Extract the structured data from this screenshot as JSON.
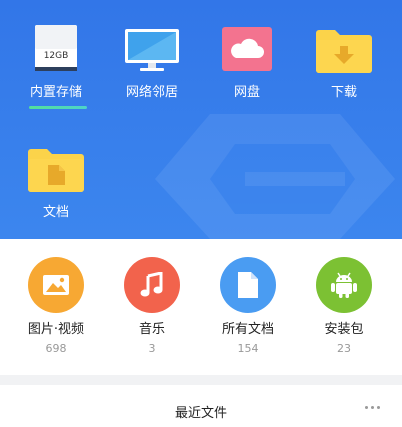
{
  "locations": [
    {
      "label": "内置存储",
      "icon": "storage-drive-icon",
      "capacity": "12GB",
      "active": true
    },
    {
      "label": "网络邻居",
      "icon": "monitor-icon"
    },
    {
      "label": "网盘",
      "icon": "cloud-icon"
    },
    {
      "label": "下载",
      "icon": "download-folder-icon"
    },
    {
      "label": "文档",
      "icon": "document-folder-icon"
    }
  ],
  "categories": [
    {
      "label": "图片·视频",
      "count": "698",
      "icon": "image-icon",
      "color": "#f7a833"
    },
    {
      "label": "音乐",
      "count": "3",
      "icon": "music-note-icon",
      "color": "#f2634c"
    },
    {
      "label": "所有文档",
      "count": "154",
      "icon": "document-icon",
      "color": "#4a9cf2"
    },
    {
      "label": "安装包",
      "count": "23",
      "icon": "android-icon",
      "color": "#7cc133"
    }
  ],
  "recent": {
    "title": "最近文件",
    "more_icon": "more-dots-icon"
  },
  "colors": {
    "hero_top": "#3276e8",
    "hero_bottom": "#3c86ee",
    "active_underline": "#53e09a",
    "cloud_tile": "#f3738f",
    "folder_yellow": "#fbd34a"
  }
}
